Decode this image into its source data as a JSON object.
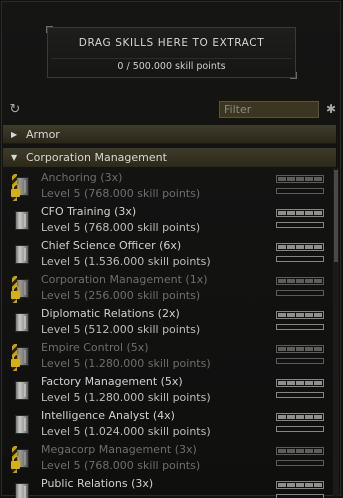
{
  "extract": {
    "title": "DRAG SKILLS HERE TO EXTRACT",
    "points": "0 / 500.000 skill points"
  },
  "toolbar": {
    "filter_placeholder": "Filter",
    "refresh_icon": "refresh-icon",
    "settings_icon": "gear-icon"
  },
  "groups": [
    {
      "label": "Armor",
      "expanded": false
    },
    {
      "label": "Corporation Management",
      "expanded": true
    }
  ],
  "skills": [
    {
      "name": "Anchoring (3x)",
      "level": "Level 5 (768.000 skill points)",
      "locked": true
    },
    {
      "name": "CFO Training (3x)",
      "level": "Level 5 (768.000 skill points)",
      "locked": false
    },
    {
      "name": "Chief Science Officer (6x)",
      "level": "Level 5 (1.536.000 skill points)",
      "locked": false
    },
    {
      "name": "Corporation Management (1x)",
      "level": "Level 5 (256.000 skill points)",
      "locked": true
    },
    {
      "name": "Diplomatic Relations (2x)",
      "level": "Level 5 (512.000 skill points)",
      "locked": false
    },
    {
      "name": "Empire Control (5x)",
      "level": "Level 5 (1.280.000 skill points)",
      "locked": true
    },
    {
      "name": "Factory Management (5x)",
      "level": "Level 5 (1.280.000 skill points)",
      "locked": false
    },
    {
      "name": "Intelligence Analyst (4x)",
      "level": "Level 5 (1.024.000 skill points)",
      "locked": false
    },
    {
      "name": "Megacorp Management (3x)",
      "level": "Level 5 (768.000 skill points)",
      "locked": true
    },
    {
      "name": "Public Relations (3x)",
      "level": "",
      "locked": false
    }
  ],
  "colors": {
    "accent": "#d4b014",
    "header_bg": "#3f3b2b",
    "filter_bg": "#3b3622"
  }
}
